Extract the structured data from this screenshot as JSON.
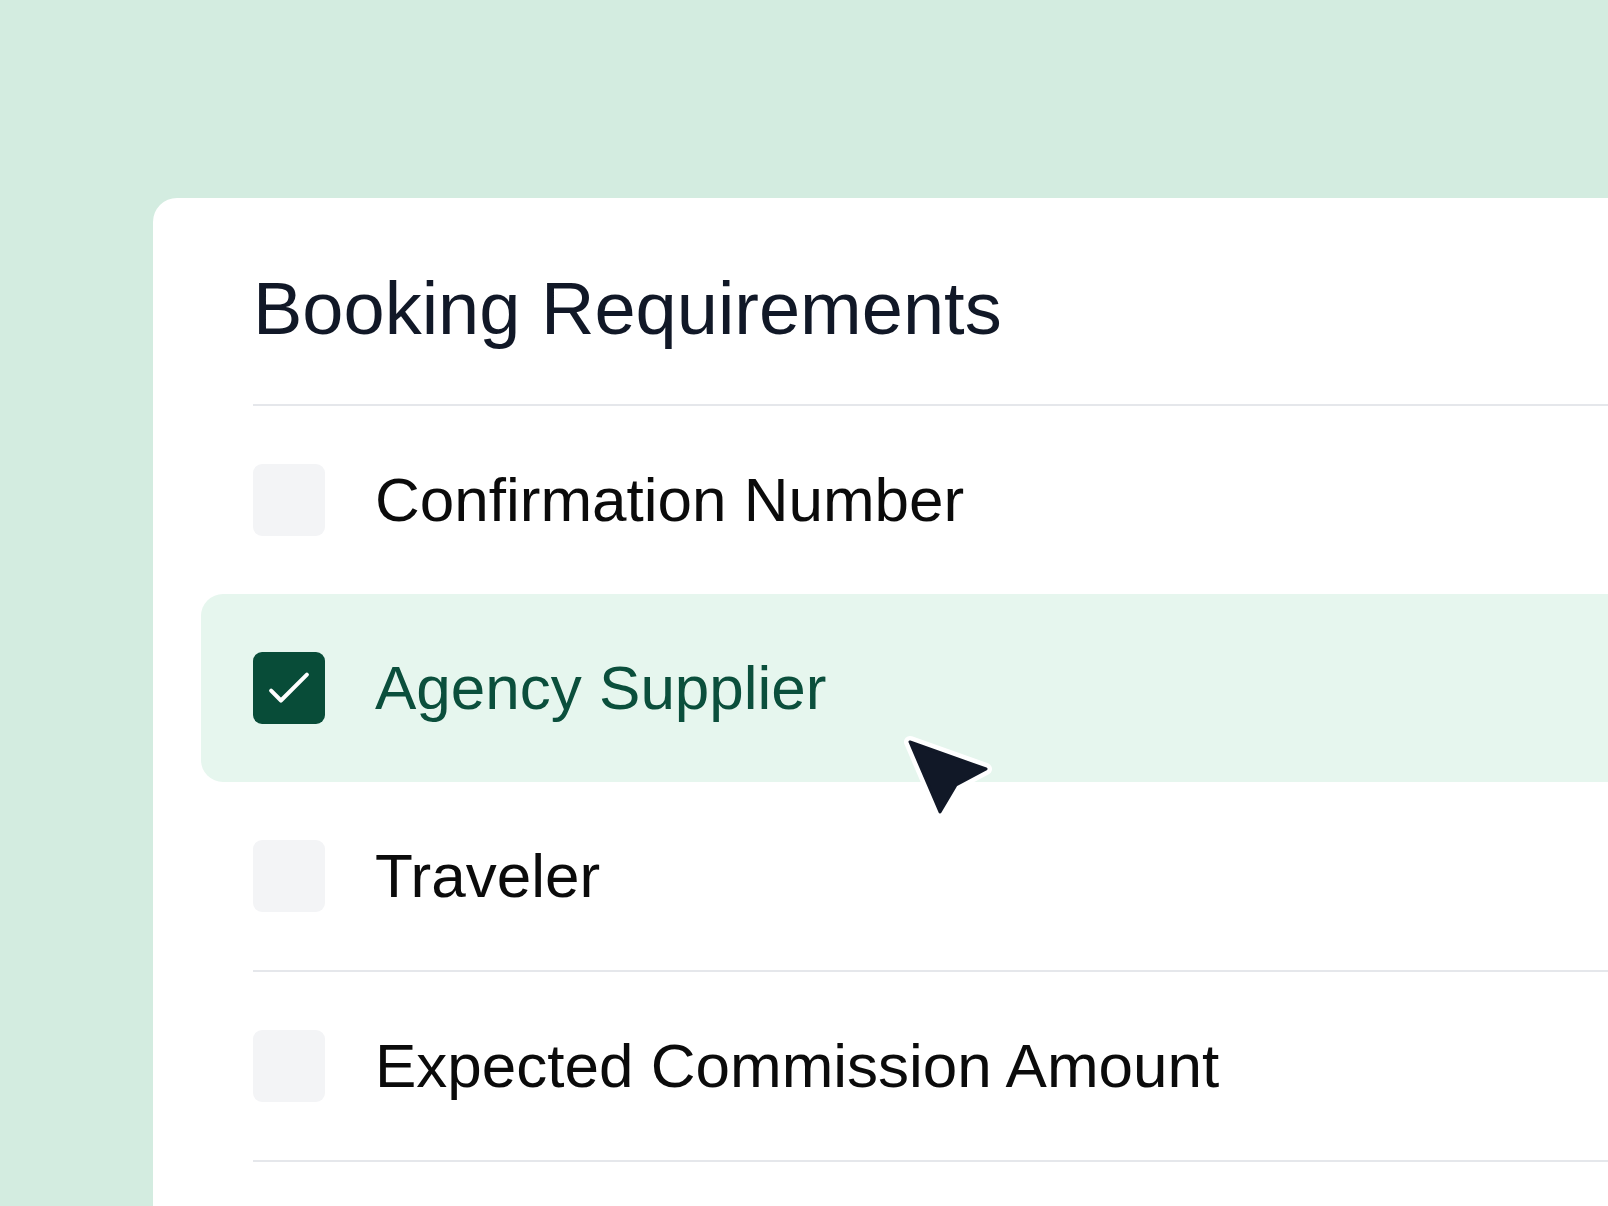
{
  "card": {
    "title": "Booking Requirements",
    "sections": [
      {
        "items": [
          {
            "label": "Confirmation Number",
            "checked": false
          },
          {
            "label": "Agency Supplier",
            "checked": true
          },
          {
            "label": "Traveler",
            "checked": false
          }
        ]
      },
      {
        "items": [
          {
            "label": "Expected Commission Amount",
            "checked": false
          }
        ]
      }
    ]
  }
}
